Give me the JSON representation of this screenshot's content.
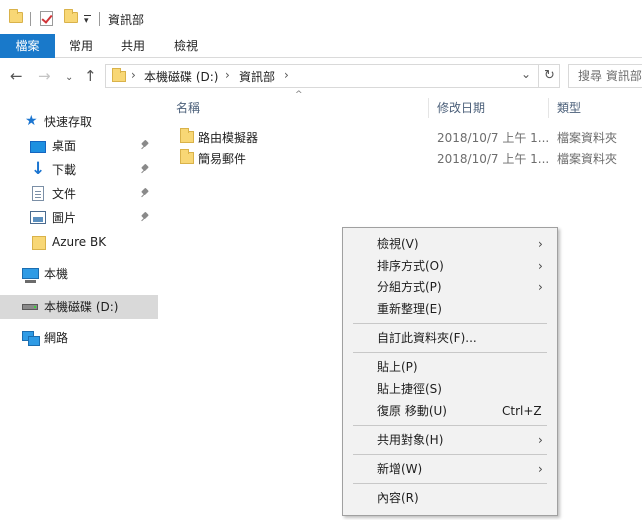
{
  "window": {
    "title": "資訊部"
  },
  "ribbon": {
    "tabs": [
      "檔案",
      "常用",
      "共用",
      "檢視"
    ]
  },
  "address": {
    "crumbs": [
      "本機磁碟 (D:)",
      "資訊部"
    ],
    "search_placeholder": "搜尋 資訊部"
  },
  "sidebar": {
    "quick_access": "快速存取",
    "items": [
      "桌面",
      "下載",
      "文件",
      "圖片",
      "Azure BK"
    ],
    "this_pc": "本機",
    "drive": "本機磁碟 (D:)",
    "network": "網路"
  },
  "columns": {
    "name": "名稱",
    "modified": "修改日期",
    "type": "類型"
  },
  "files": [
    {
      "name": "路由模擬器",
      "modified": "2018/10/7 上午 1...",
      "type": "檔案資料夾"
    },
    {
      "name": "簡易郵件",
      "modified": "2018/10/7 上午 1...",
      "type": "檔案資料夾"
    }
  ],
  "context_menu": {
    "view": "檢視(V)",
    "sort_by": "排序方式(O)",
    "group_by": "分組方式(P)",
    "refresh": "重新整理(E)",
    "customize": "自訂此資料夾(F)...",
    "paste": "貼上(P)",
    "paste_shortcut": "貼上捷徑(S)",
    "undo_move": "復原 移動(U)",
    "undo_shortcut": "Ctrl+Z",
    "give_access": "共用對象(H)",
    "new": "新增(W)",
    "properties": "內容(R)"
  },
  "colors": {
    "accent": "#1979ca",
    "selection": "#d9d9d9",
    "menu_bg": "#f2f2f2"
  },
  "icons": [
    "folder-icon",
    "checkmark-icon",
    "back-arrow-icon",
    "forward-arrow-icon",
    "up-arrow-icon",
    "refresh-icon",
    "star-icon",
    "pin-icon",
    "download-icon",
    "document-icon",
    "picture-icon",
    "computer-icon",
    "drive-icon",
    "network-icon",
    "chevron-right-icon"
  ]
}
